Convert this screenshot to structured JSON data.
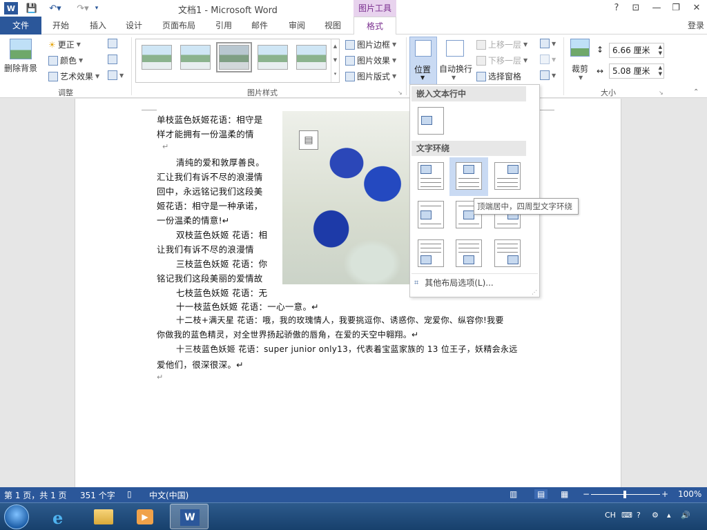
{
  "title_bar": {
    "logo": "W",
    "document_title": "文档1 - Microsoft Word",
    "context_tools": "图片工具",
    "icons": {
      "save": "save-icon",
      "undo": "undo-icon",
      "redo": "redo-icon"
    },
    "window_controls": [
      "?",
      "⊡",
      "—",
      "❐",
      "✕"
    ]
  },
  "tabs": [
    "文件",
    "开始",
    "插入",
    "设计",
    "页面布局",
    "引用",
    "邮件",
    "审阅",
    "视图",
    "格式"
  ],
  "active_tab": "格式",
  "sign_in": "登录",
  "ribbon": {
    "adjust": {
      "remove_bg": "删除背景",
      "corrections": "更正",
      "color": "颜色",
      "artistic": "艺术效果",
      "group_label": "调整"
    },
    "picture_styles": {
      "border": "图片边框",
      "effects": "图片效果",
      "layout": "图片版式",
      "group_label": "图片样式"
    },
    "arrange": {
      "position": "位置",
      "wrap_text": "自动换行",
      "bring_forward": "上移一层",
      "send_backward": "下移一层",
      "selection_pane": "选择窗格"
    },
    "size": {
      "crop": "裁剪",
      "height": "6.66 厘米",
      "width": "5.08 厘米",
      "group_label": "大小"
    }
  },
  "document": {
    "lines": [
      "单枝蓝色妖姬花语：相守是",
      "样才能拥有一份温柔的情",
      "↵",
      "清纯的爱和敦厚善良。",
      "汇让我们有诉不尽的浪漫情",
      "回中，永远铭记我们这段美",
      "姬花语：相守是一种承诺，",
      "一份温柔的情意!↵",
      "双枝蓝色妖姬  花语：相",
      "让我们有诉不尽的浪漫情",
      "三枝蓝色妖姬  花语：你",
      "铭记我们这段美丽的爱情故",
      "七枝蓝色妖姬  花语：无",
      "十一枝蓝色妖姬  花语：一心一意。↵",
      "十二枝+满天星  花语：哦，我的玫瑰情人，我要挑逗你、诱惑你、宠爱你、纵容你!我要",
      "你做我的蓝色精灵，对全世界扬起骄傲的唇角，在爱的天空中翱翔。↵",
      "十三枝蓝色妖姬  花语：super junior only13，代表着宝蓝家族的 13 位王子，妖精会永远",
      "爱他们，很深很深。↵",
      "↵"
    ]
  },
  "position_menu": {
    "inline_header": "嵌入文本行中",
    "wrap_header": "文字环绕",
    "more_options": "其他布局选项(L)...",
    "tooltip": "顶端居中，四周型文字环绕"
  },
  "status_bar": {
    "page": "第 1 页，共 1 页",
    "words": "351 个字",
    "language": "中文(中国)",
    "zoom": "100%",
    "zoom_level": 1.0
  },
  "taskbar": {
    "apps": [
      "start-orb-icon",
      "ie-icon",
      "explorer-icon",
      "media-player-icon",
      "word-icon"
    ],
    "tray_lang": "CH"
  },
  "colors": {
    "accent": "#2b579a",
    "picture_tools": "#7a2f8f"
  }
}
